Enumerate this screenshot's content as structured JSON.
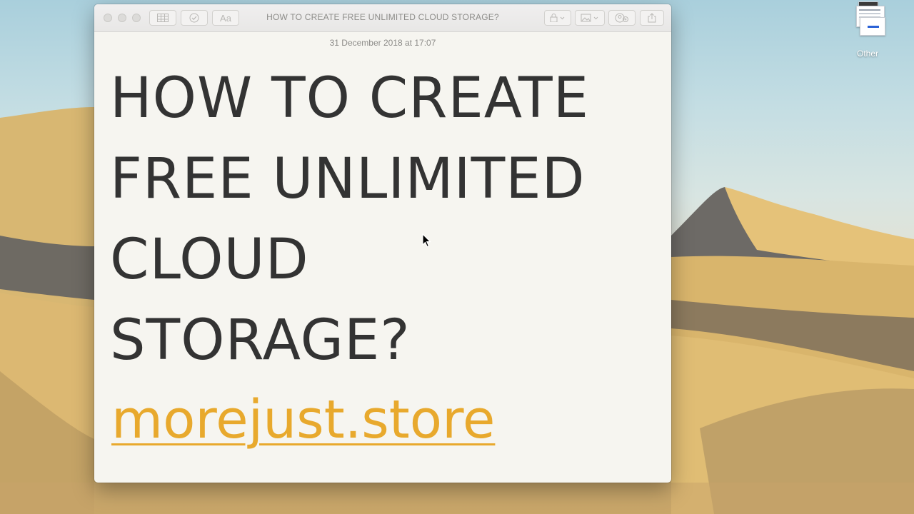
{
  "desktop": {
    "icon_label": "Other"
  },
  "window": {
    "title": "HOW TO CREATE FREE UNLIMITED CLOUD STORAGE?",
    "toolbar": {
      "format_label": "Aa",
      "left_icons": [
        "table-icon",
        "checklist-icon",
        "format-icon"
      ],
      "right_icons": [
        "lock-icon",
        "media-icon",
        "collaborate-icon",
        "share-icon"
      ]
    }
  },
  "note": {
    "date": "31 December 2018 at 17:07",
    "heading_lines": [
      "HOW TO CREATE",
      "FREE UNLIMITED",
      "CLOUD",
      "STORAGE?"
    ],
    "link": "morejust.store"
  },
  "colors": {
    "link": "#e8a92d",
    "text": "#333333",
    "paper": "#f6f5f0"
  }
}
